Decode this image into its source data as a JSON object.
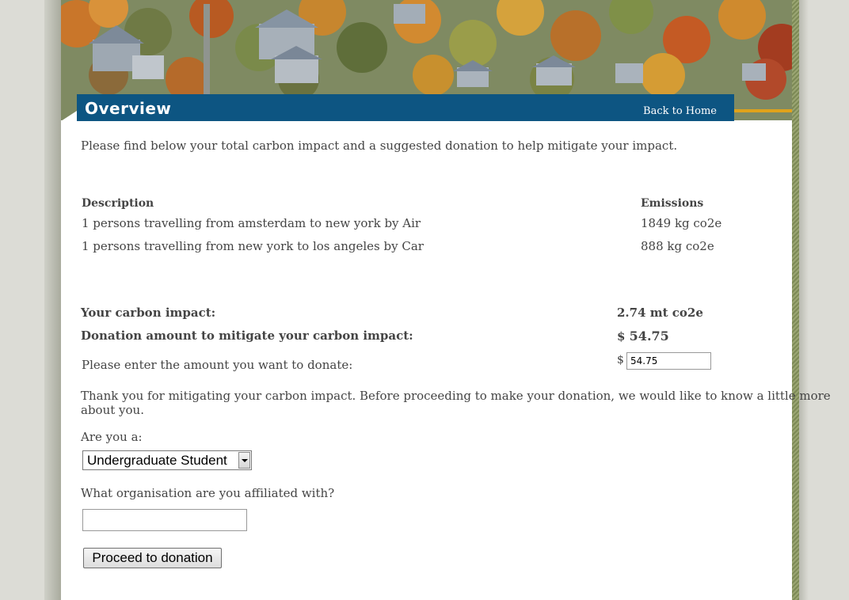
{
  "header": {
    "title": "Overview",
    "back_link": "Back to Home"
  },
  "intro": "Please find below your total carbon impact and a suggested donation to help mitigate your impact.",
  "table": {
    "headers": [
      "Description",
      "Emissions"
    ],
    "rows": [
      {
        "description": "1 persons travelling from amsterdam to new york by Air",
        "emissions": "1849 kg co2e"
      },
      {
        "description": "1 persons travelling from new york to los angeles by Car",
        "emissions": "888 kg co2e"
      }
    ]
  },
  "summary": {
    "impact_label": "Your carbon impact:",
    "impact_value": "2.74 mt co2e",
    "donation_label": "Donation amount to mitigate your carbon impact:",
    "donation_currency": "$",
    "donation_value": "54.75",
    "enter_label": "Please enter the amount you want to donate:",
    "enter_currency": "$",
    "enter_value": "54.75"
  },
  "thanks": {
    "line1": "Thank you for mitigating your carbon impact. Before proceeding to make your donation, we would like to know a little more",
    "line2": "about you."
  },
  "form": {
    "role_label": "Are you a:",
    "role_selected": "Undergraduate Student",
    "org_label": "What organisation are you affiliated with?",
    "org_value": "",
    "submit_label": "Proceed to donation"
  },
  "colors": {
    "title_bar": "#0d5582",
    "accent_gold": "#e0a21a"
  }
}
